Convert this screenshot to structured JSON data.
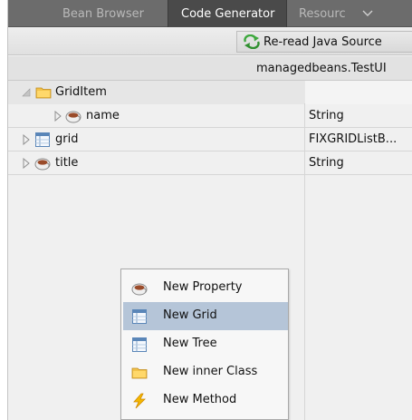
{
  "tabs": [
    {
      "label": "Bean Browser",
      "active": false
    },
    {
      "label": "Code Generator",
      "active": true
    },
    {
      "label": "Resourc",
      "active": false
    }
  ],
  "toolbar": {
    "reread_label": "Re-read Java Source"
  },
  "class_bar": {
    "label": "managedbeans.TestUI"
  },
  "tree": {
    "rows": [
      {
        "name": "GridItem",
        "type": "",
        "icon": "folder-icon",
        "expanded": true
      },
      {
        "name": "name",
        "type": "String",
        "icon": "bean-icon",
        "expanded": false
      },
      {
        "name": "grid",
        "type": "FIXGRIDListB...",
        "icon": "grid-icon",
        "expanded": false
      },
      {
        "name": "title",
        "type": "String",
        "icon": "bean-icon",
        "expanded": false
      }
    ]
  },
  "context_menu": {
    "items": [
      {
        "label": "New Property",
        "icon": "bean-icon"
      },
      {
        "label": "New Grid",
        "icon": "grid-icon",
        "highlighted": true
      },
      {
        "label": "New Tree",
        "icon": "grid-icon"
      },
      {
        "label": "New inner Class",
        "icon": "folder-icon"
      },
      {
        "label": "New Method",
        "icon": "lightning-icon"
      }
    ]
  },
  "colors": {
    "tab_bar": "#6c6c6c",
    "active_tab": "#4a4a4a",
    "menu_highlight": "#b5c5d8"
  }
}
